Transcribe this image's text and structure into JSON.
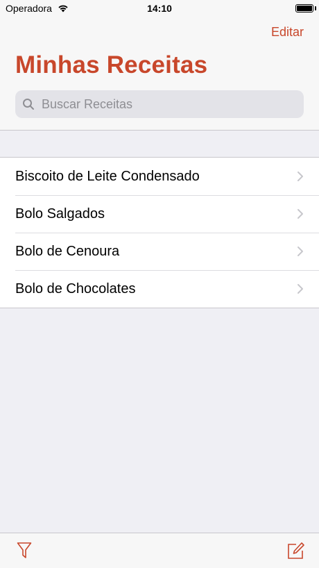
{
  "status_bar": {
    "carrier": "Operadora",
    "time": "14:10"
  },
  "nav": {
    "edit_label": "Editar",
    "title": "Minhas Receitas"
  },
  "search": {
    "placeholder": "Buscar Receitas"
  },
  "recipes": [
    {
      "name": "Biscoito de Leite Condensado"
    },
    {
      "name": "Bolo Salgados"
    },
    {
      "name": "Bolo de Cenoura"
    },
    {
      "name": "Bolo de Chocolates"
    }
  ],
  "toolbar": {
    "filter_icon": "filter-icon",
    "compose_icon": "compose-icon"
  },
  "colors": {
    "accent": "#c8472b",
    "background": "#efeff4"
  }
}
